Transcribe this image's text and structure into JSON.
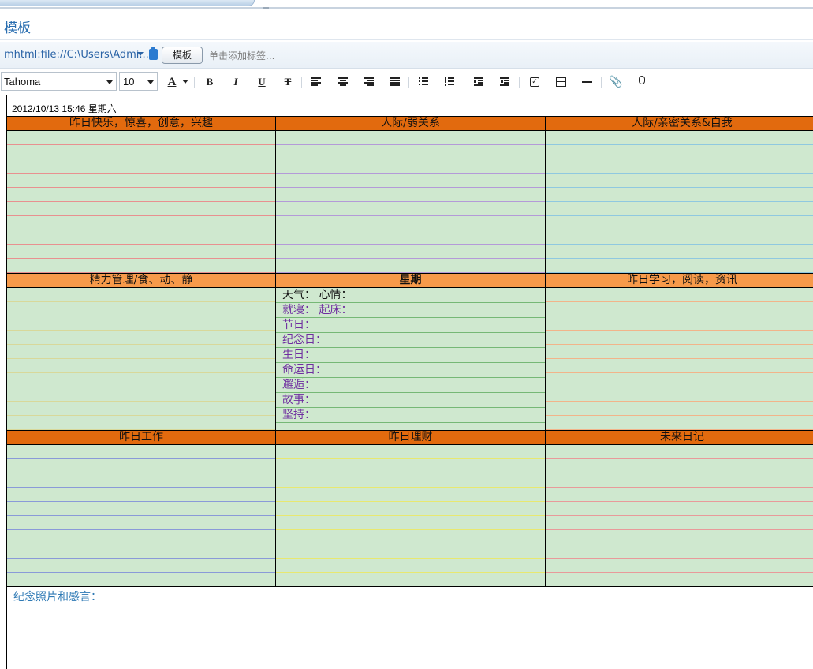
{
  "window": {
    "title": "模板"
  },
  "address": {
    "url": "mhtml:file://C:\\Users\\Admi...",
    "notebook_button": "模板",
    "add_tag_placeholder": "单击添加标签..."
  },
  "toolbar": {
    "font": "Tahoma",
    "size": "10",
    "buttons": [
      "font-color",
      "bold",
      "italic",
      "underline",
      "strikethrough",
      "align-left",
      "align-center",
      "align-right",
      "justify",
      "bullet-list",
      "numbered-list",
      "outdent",
      "indent",
      "checkbox",
      "table",
      "horizontal-rule",
      "attach",
      "record"
    ]
  },
  "note": {
    "datetime": "2012/10/13 15:46   星期六",
    "sections": [
      {
        "title": "昨日快乐，惊喜，创意，兴趣"
      },
      {
        "title": "人际/弱关系"
      },
      {
        "title": "人际/亲密关系&自我"
      },
      {
        "title": "精力管理/食、动、静"
      },
      {
        "title": "星期"
      },
      {
        "title": "昨日学习，阅读，资讯"
      },
      {
        "title": "昨日工作"
      },
      {
        "title": "昨日理财"
      },
      {
        "title": "未来日记"
      }
    ],
    "week_items": [
      "天气：  心情：",
      "就寝：  起床：",
      "节日：",
      "纪念日：",
      "生日：",
      "命运日：",
      "邂逅：",
      "故事：",
      "坚持："
    ],
    "memo": "纪念照片和感言："
  },
  "colors": {
    "header_dark": "#e26a0e",
    "header_light": "#f79a4a",
    "cell_green": "#cfe8cf",
    "title_blue": "#2a6eb0"
  }
}
